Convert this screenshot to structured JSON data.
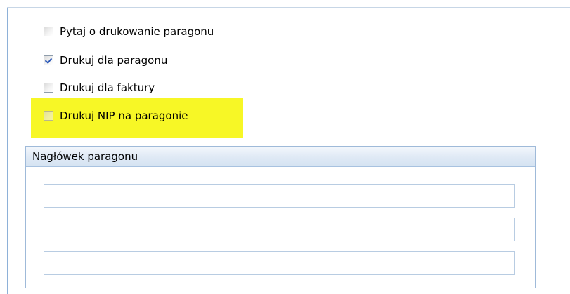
{
  "options": {
    "ask_print_receipt": {
      "label": "Pytaj o drukowanie paragonu",
      "checked": false
    },
    "print_for_receipt": {
      "label": "Drukuj dla paragonu",
      "checked": true
    },
    "print_for_invoice": {
      "label": "Drukuj dla faktury",
      "checked": false
    },
    "print_nip_on_receipt": {
      "label": "Drukuj NIP na paragonie",
      "checked": false,
      "highlighted": true
    }
  },
  "receipt_header": {
    "title": "Nagłówek paragonu",
    "lines": [
      "",
      "",
      ""
    ]
  },
  "colors": {
    "highlight": "#f7f726",
    "group_border": "#9fbad9",
    "check_mark": "#2b58b8"
  }
}
